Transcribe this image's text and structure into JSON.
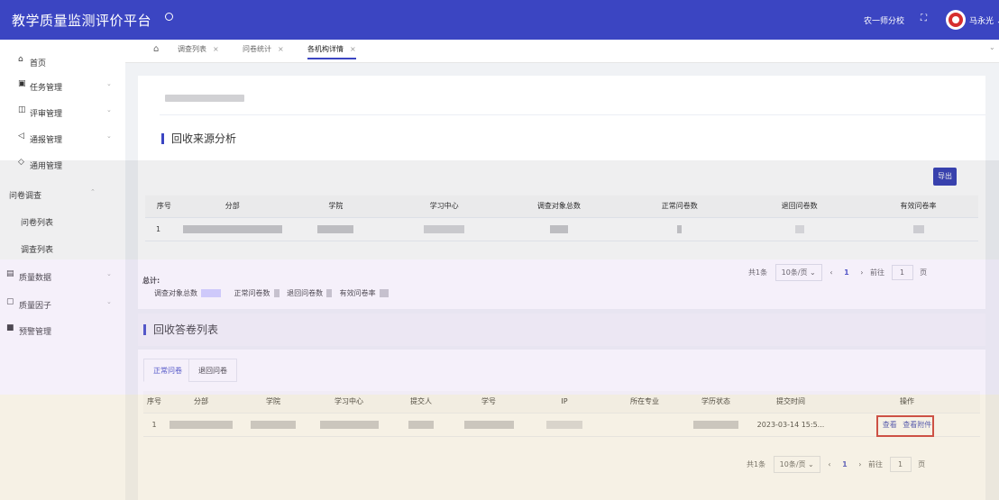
{
  "header": {
    "app_title": "教学质量监测评价平台",
    "school": "农一师分校",
    "user": "马永光"
  },
  "sidebar": {
    "items": [
      {
        "label": "首页",
        "icon": "home-icon",
        "glyph": "⌂"
      },
      {
        "label": "任务管理",
        "icon": "task-icon",
        "glyph": "▣"
      },
      {
        "label": "评审管理",
        "icon": "review-icon",
        "glyph": "◫"
      },
      {
        "label": "通报管理",
        "icon": "notice-icon",
        "glyph": "◁"
      },
      {
        "label": "通用管理",
        "icon": "tag-icon",
        "glyph": "◇"
      },
      {
        "label": "问卷调查"
      },
      {
        "label": "问卷列表"
      },
      {
        "label": "调查列表"
      },
      {
        "label": "质量数据",
        "icon": "data-icon",
        "glyph": "▤"
      },
      {
        "label": "质量因子",
        "icon": "factor-icon",
        "glyph": "▢"
      },
      {
        "label": "预警管理",
        "icon": "warning-icon",
        "glyph": "■"
      }
    ]
  },
  "tabs": [
    "调查列表",
    "问卷统计",
    "各机构详情"
  ],
  "source": {
    "section_title": "回收来源分析",
    "export_label": "导出",
    "columns": [
      "序号",
      "分部",
      "学院",
      "学习中心",
      "调查对象总数",
      "正常问卷数",
      "退回问卷数",
      "有效问卷率"
    ],
    "rows": [
      {
        "index": "1"
      }
    ],
    "pager": {
      "total": "共1条",
      "page_size": "10条/页",
      "page": "1",
      "goto": "前往",
      "goto_value": "1",
      "unit": "页"
    },
    "summary_label": "总计:",
    "summary_items": [
      "调查对象总数",
      "正常问卷数",
      "退回问卷数",
      "有效问卷率"
    ]
  },
  "answers": {
    "section_title": "回收答卷列表",
    "subtabs": [
      "正常问卷",
      "退回问卷"
    ],
    "columns": [
      "序号",
      "分部",
      "学院",
      "学习中心",
      "提交人",
      "学号",
      "IP",
      "所在专业",
      "学历状态",
      "提交时间",
      "操作"
    ],
    "rows": [
      {
        "index": "1",
        "submit_time": "2023-03-14 15:5...",
        "view": "查看",
        "view_attachment": "查看附件"
      }
    ],
    "pager": {
      "total": "共1条",
      "page_size": "10条/页",
      "page": "1",
      "goto": "前往",
      "goto_value": "1",
      "unit": "页"
    }
  },
  "colors": {
    "brand": "#3b45c2",
    "button": "#2f3ab3",
    "highlight": "#c92a2a"
  }
}
